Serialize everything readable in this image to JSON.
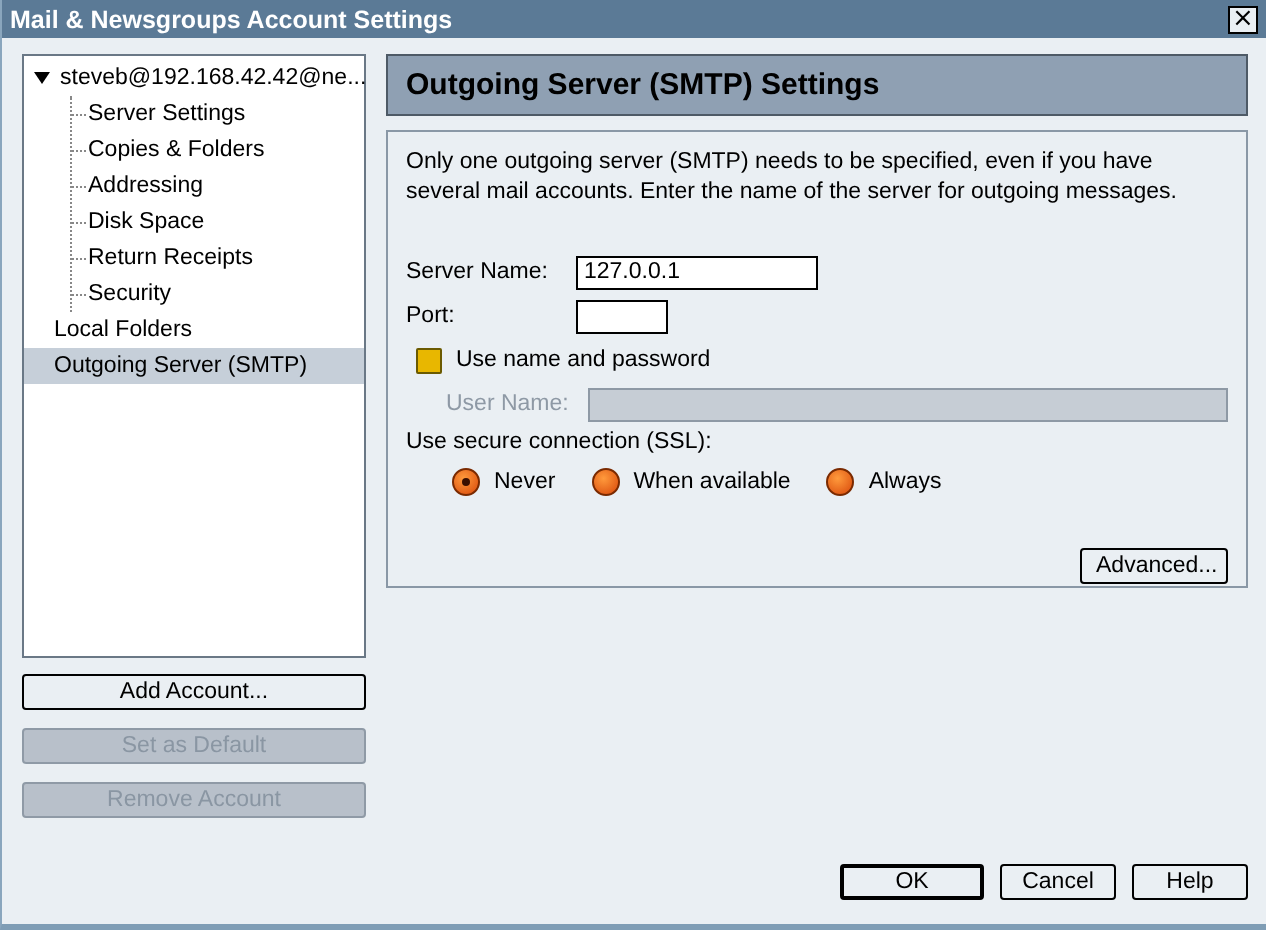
{
  "window": {
    "title": "Mail & Newsgroups Account Settings",
    "close": "×"
  },
  "tree": [
    {
      "label": "steveb@192.168.42.42@ne...",
      "expanded": true,
      "selected": false,
      "children": [
        {
          "label": "Server Settings",
          "selected": false
        },
        {
          "label": "Copies & Folders",
          "selected": false
        },
        {
          "label": "Addressing",
          "selected": false
        },
        {
          "label": "Disk Space",
          "selected": false
        },
        {
          "label": "Return Receipts",
          "selected": false
        },
        {
          "label": "Security",
          "selected": false
        }
      ]
    },
    {
      "label": "Local Folders",
      "selected": false
    },
    {
      "label": "Outgoing Server (SMTP)",
      "selected": true
    }
  ],
  "account_buttons": [
    {
      "label": "Add Account...",
      "disabled": false
    },
    {
      "label": "Set as Default",
      "disabled": true
    },
    {
      "label": "Remove Account",
      "disabled": true
    }
  ],
  "panel": {
    "title": "Outgoing Server (SMTP) Settings",
    "description": "Only one outgoing server (SMTP) needs to be specified, even if you have several mail accounts. Enter the name of the server for outgoing messages.",
    "server_name": {
      "label": "Server Name:",
      "value": "127.0.0.1"
    },
    "port": {
      "label": "Port:"
    },
    "use_auth": {
      "label": "Use name and password",
      "checked": false
    },
    "user_name": {
      "label": "User Name:",
      "disabled": true
    },
    "ssl": {
      "label": "Use secure connection (SSL):",
      "options": [
        {
          "label": "Never",
          "selected": true
        },
        {
          "label": "When available",
          "selected": false
        },
        {
          "label": "Always",
          "selected": false
        }
      ]
    },
    "advanced_button": "Advanced..."
  },
  "dialog_buttons": [
    {
      "label": "OK",
      "default": true
    },
    {
      "label": "Cancel",
      "default": false
    },
    {
      "label": "Help",
      "default": false
    }
  ]
}
